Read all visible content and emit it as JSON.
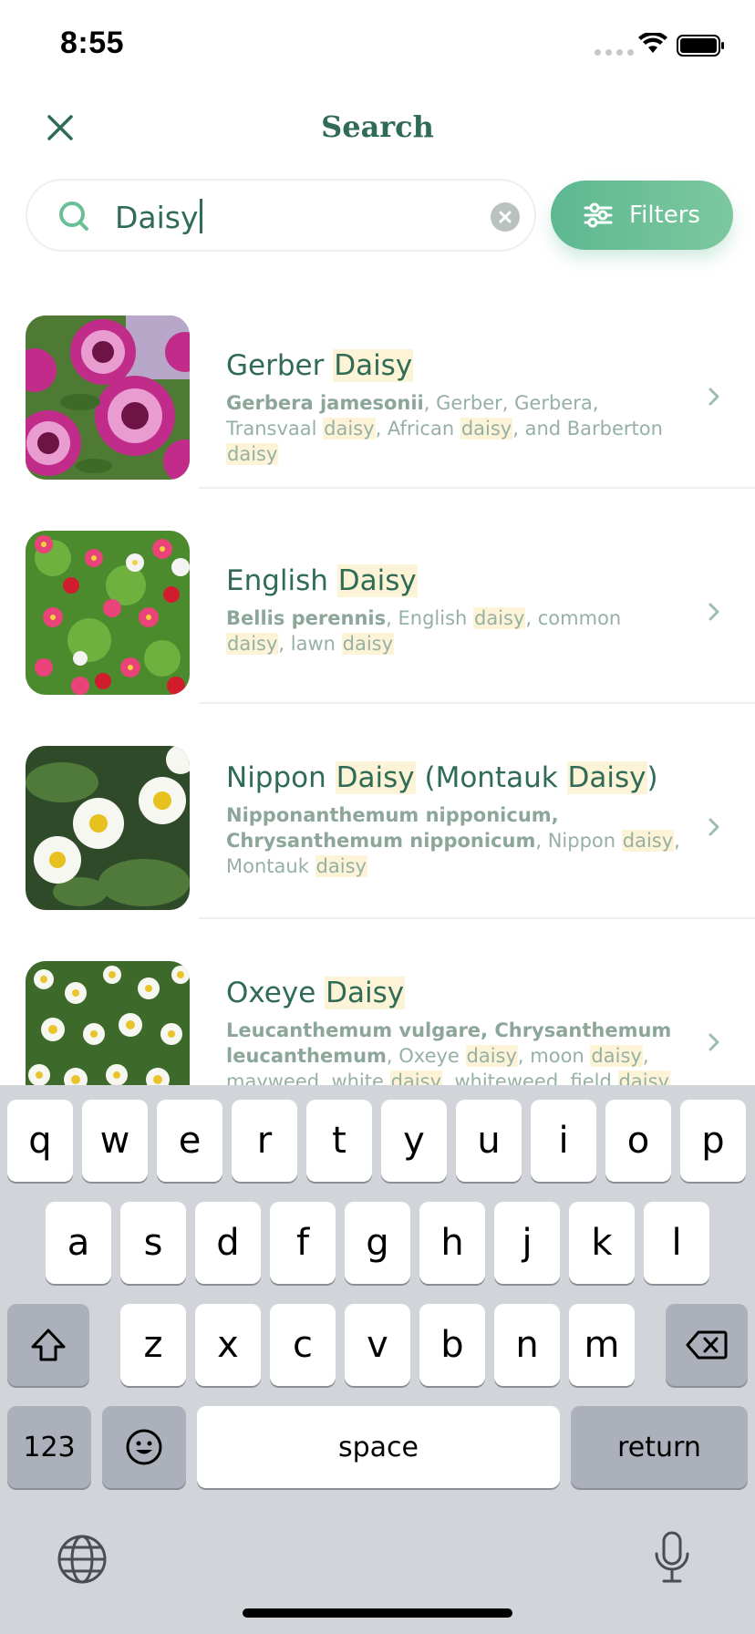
{
  "status_bar": {
    "time": "8:55"
  },
  "header": {
    "title": "Search"
  },
  "search": {
    "value": "Daisy"
  },
  "filters_button": {
    "label": "Filters"
  },
  "results": [
    {
      "title_before": "Gerber ",
      "title_highlight": "Daisy",
      "title_after": "",
      "desc_bold": "Gerbera jamesonii",
      "desc_parts": [
        ", Gerber, Gerbera, Transvaal ",
        "daisy",
        ", African ",
        "daisy",
        ", and Barberton ",
        "daisy",
        ""
      ]
    },
    {
      "title_before": "English ",
      "title_highlight": "Daisy",
      "title_after": "",
      "desc_bold": "Bellis perennis",
      "desc_parts": [
        ", English ",
        "daisy",
        ", common ",
        "daisy",
        ", lawn ",
        "daisy",
        ""
      ]
    },
    {
      "title_before": "Nippon ",
      "title_highlight": "Daisy",
      "title_mid": " (Montauk ",
      "title_highlight2": "Daisy",
      "title_after": ")",
      "desc_bold": "Nipponanthemum nipponicum, Chrysanthemum nipponicum",
      "desc_parts": [
        ", Nippon ",
        "daisy",
        ", Montauk ",
        "daisy",
        ""
      ]
    },
    {
      "title_before": "Oxeye ",
      "title_highlight": "Daisy",
      "title_after": "",
      "desc_bold": "Leucanthemum vulgare, Chrysanthemum leucanthemum",
      "desc_parts": [
        ", Oxeye ",
        "daisy",
        ", moon ",
        "daisy",
        ", mayweed, white ",
        "daisy",
        ", whiteweed, field ",
        "daisy",
        ","
      ]
    }
  ],
  "keyboard": {
    "row1": [
      "q",
      "w",
      "e",
      "r",
      "t",
      "y",
      "u",
      "i",
      "o",
      "p"
    ],
    "row2": [
      "a",
      "s",
      "d",
      "f",
      "g",
      "h",
      "j",
      "k",
      "l"
    ],
    "row3": [
      "z",
      "x",
      "c",
      "v",
      "b",
      "n",
      "m"
    ],
    "numbers_key": "123",
    "space_key": "space",
    "return_key": "return"
  },
  "icons": {
    "close": "close-icon",
    "search": "search-icon",
    "clear": "clear-icon",
    "filters": "sliders-icon",
    "chevron": "chevron-right-icon",
    "shift": "shift-icon",
    "delete": "backspace-icon",
    "emoji": "emoji-icon",
    "globe": "globe-icon",
    "mic": "microphone-icon"
  },
  "colors": {
    "accent": "#2f6b55",
    "button": "#6abf97",
    "highlight": "#fdf4d8",
    "muted": "#96b0a4"
  }
}
